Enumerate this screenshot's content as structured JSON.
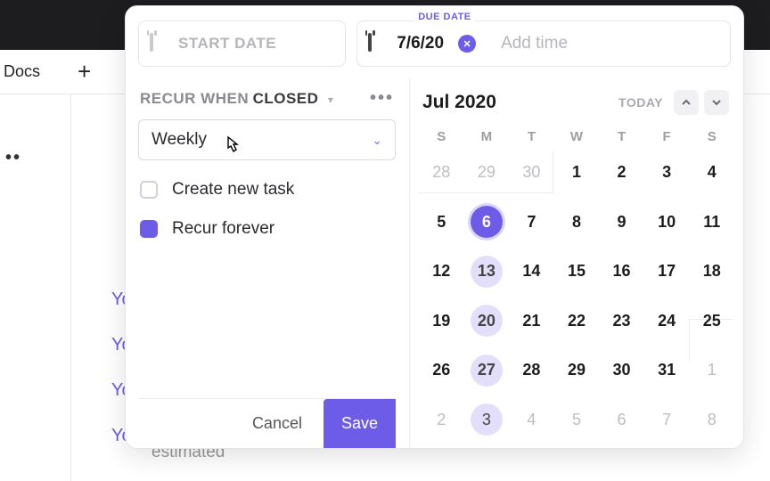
{
  "background": {
    "docs_label": "Docs",
    "plus": "+",
    "dots": "••",
    "activity_prefixes": [
      "Yo",
      "Yo",
      "Yo",
      "Yo"
    ],
    "estimated": "estimated"
  },
  "date_inputs": {
    "start_placeholder": "START DATE",
    "due_label": "DUE DATE",
    "due_value": "7/6/20",
    "add_time": "Add time",
    "clear_glyph": "✕"
  },
  "recur": {
    "label_prefix": "RECUR WHEN",
    "state": "CLOSED",
    "more": "•••",
    "frequency": "Weekly",
    "option_create_new": "Create new task",
    "option_recur_forever": "Recur forever",
    "create_new_checked": false,
    "recur_forever_checked": true
  },
  "footer": {
    "cancel": "Cancel",
    "save": "Save"
  },
  "calendar": {
    "month": "Jul 2020",
    "today_label": "TODAY",
    "dow": [
      "S",
      "M",
      "T",
      "W",
      "T",
      "F",
      "S"
    ],
    "weeks": [
      [
        {
          "d": 28,
          "muted": true
        },
        {
          "d": 29,
          "muted": true
        },
        {
          "d": 30,
          "muted": true
        },
        {
          "d": 1
        },
        {
          "d": 2
        },
        {
          "d": 3
        },
        {
          "d": 4
        }
      ],
      [
        {
          "d": 5
        },
        {
          "d": 6,
          "selected": true
        },
        {
          "d": 7
        },
        {
          "d": 8
        },
        {
          "d": 9
        },
        {
          "d": 10
        },
        {
          "d": 11
        }
      ],
      [
        {
          "d": 12
        },
        {
          "d": 13,
          "recur": true
        },
        {
          "d": 14
        },
        {
          "d": 15
        },
        {
          "d": 16
        },
        {
          "d": 17
        },
        {
          "d": 18
        }
      ],
      [
        {
          "d": 19
        },
        {
          "d": 20,
          "recur": true
        },
        {
          "d": 21
        },
        {
          "d": 22
        },
        {
          "d": 23
        },
        {
          "d": 24
        },
        {
          "d": 25
        }
      ],
      [
        {
          "d": 26
        },
        {
          "d": 27,
          "recur": true
        },
        {
          "d": 28
        },
        {
          "d": 29
        },
        {
          "d": 30
        },
        {
          "d": 31
        },
        {
          "d": 1,
          "muted": true
        }
      ],
      [
        {
          "d": 2,
          "muted": true
        },
        {
          "d": 3,
          "muted": true,
          "recur": true
        },
        {
          "d": 4,
          "muted": true
        },
        {
          "d": 5,
          "muted": true
        },
        {
          "d": 6,
          "muted": true
        },
        {
          "d": 7,
          "muted": true
        },
        {
          "d": 8,
          "muted": true
        }
      ]
    ]
  }
}
